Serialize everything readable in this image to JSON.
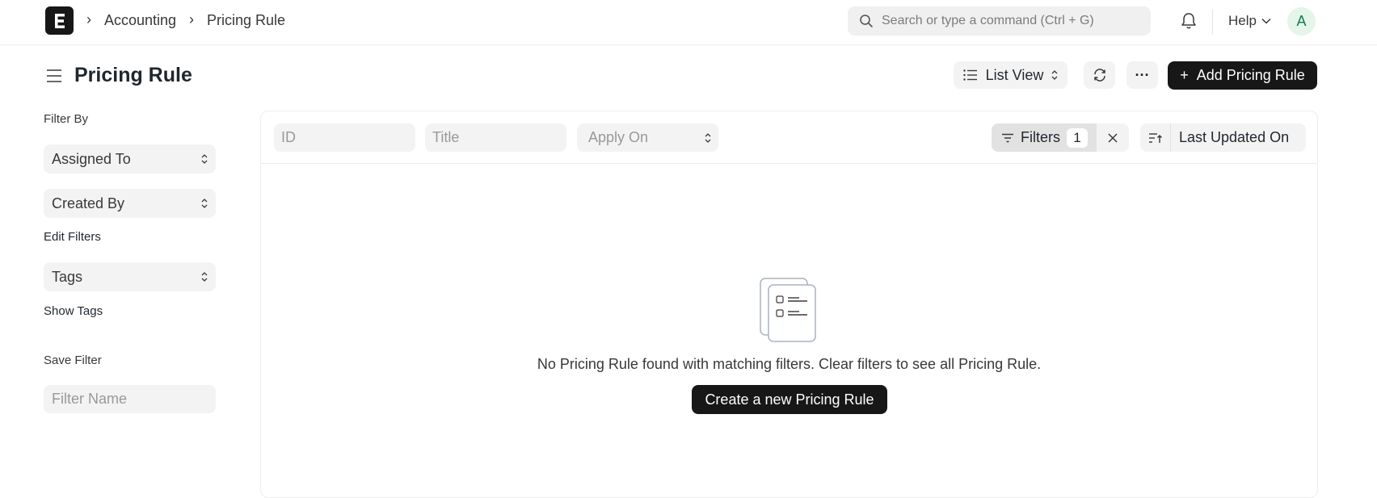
{
  "breadcrumb": {
    "items": [
      "Accounting",
      "Pricing Rule"
    ]
  },
  "search": {
    "placeholder": "Search or type a command (Ctrl + G)"
  },
  "help": {
    "label": "Help"
  },
  "user": {
    "avatar_initial": "A"
  },
  "page": {
    "title": "Pricing Rule"
  },
  "toolbar": {
    "view_label": "List View",
    "more_label": "···",
    "add_label": "Add Pricing Rule"
  },
  "sidebar": {
    "filter_by_label": "Filter By",
    "assigned_to": "Assigned To",
    "created_by": "Created By",
    "edit_filters": "Edit Filters",
    "tags": "Tags",
    "show_tags": "Show Tags",
    "save_filter": "Save Filter",
    "filter_name_placeholder": "Filter Name"
  },
  "filter_bar": {
    "id_placeholder": "ID",
    "title_placeholder": "Title",
    "apply_on_placeholder": "Apply On",
    "filters_label": "Filters",
    "filters_count": "1",
    "sort_label": "Last Updated On"
  },
  "empty_state": {
    "message": "No Pricing Rule found with matching filters. Clear filters to see all Pricing Rule.",
    "create_label": "Create a new Pricing Rule"
  },
  "colors": {
    "primary_dark": "#171717",
    "avatar_bg": "#e4f5e9",
    "avatar_fg": "#16794c"
  }
}
